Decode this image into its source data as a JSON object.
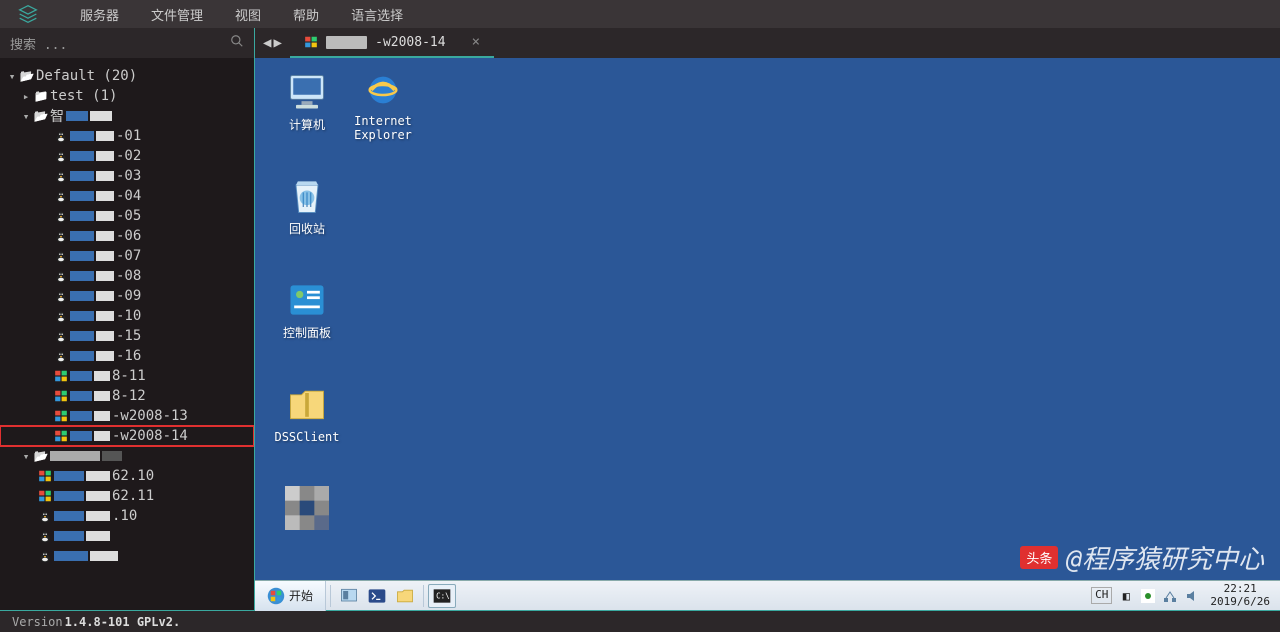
{
  "menubar": {
    "items": [
      "服务器",
      "文件管理",
      "视图",
      "帮助",
      "语言选择"
    ]
  },
  "search": {
    "placeholder": "搜索 ..."
  },
  "tab": {
    "label_suffix": "-w2008-14"
  },
  "tree": {
    "root": "Default (20)",
    "test": "test (1)",
    "group1_prefix": "智",
    "linux_suffixes": [
      "-01",
      "-02",
      "-03",
      "-04",
      "-05",
      "-06",
      "-07",
      "-08",
      "-09",
      "-10",
      "-15",
      "-16"
    ],
    "win_items": [
      "8-11",
      "8-12",
      "-w2008-13",
      "-w2008-14"
    ],
    "group2_suffixes": [
      "62.10",
      "62.11",
      ".10",
      ""
    ],
    "highlighted": "-w2008-14"
  },
  "desktop": {
    "icons": {
      "computer": "计算机",
      "ie": "Internet\nExplorer",
      "recycle": "回收站",
      "control": "控制面板",
      "dss": "DSSClient",
      "generic": ""
    }
  },
  "taskbar": {
    "start": "开始",
    "ime": "CH",
    "time": "22:21",
    "date": "2019/6/26"
  },
  "statusbar": {
    "prefix": "Version ",
    "version": "1.4.8-101 GPLv2."
  },
  "watermark": {
    "badge": "头条",
    "text": "@程序猿研究中心"
  }
}
